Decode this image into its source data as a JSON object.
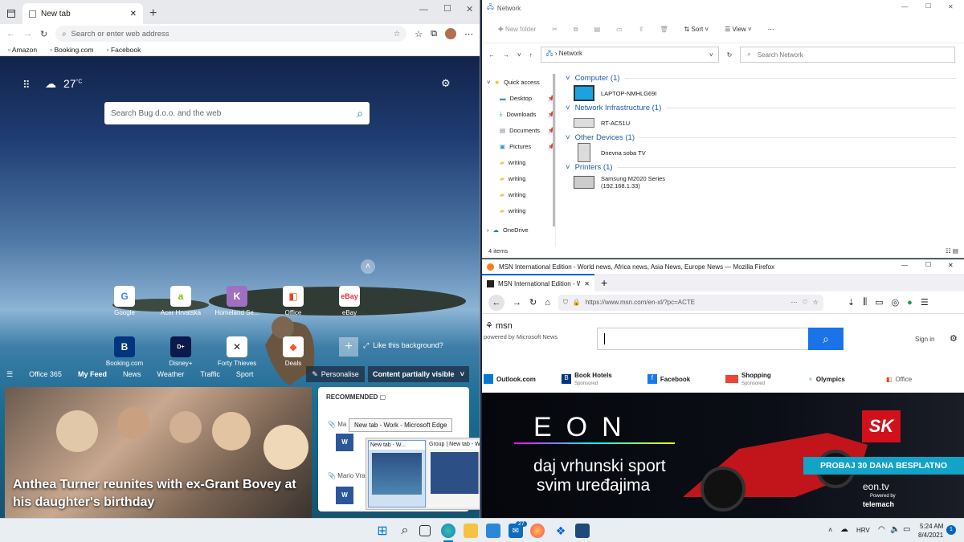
{
  "edge": {
    "tab_title": "New tab",
    "address_placeholder": "Search or enter web address",
    "favorites": [
      "Amazon",
      "Booking.com",
      "Facebook"
    ],
    "temperature": "27",
    "temp_unit": "°C",
    "search_placeholder": "Search Bug d.o.o. and the web",
    "tiles_row1": [
      "Google",
      "Acer Hrvatska",
      "Homeland Se...",
      "Office",
      "eBay"
    ],
    "tiles_row2": [
      "Booking.com",
      "Disney+",
      "Forty Thieves",
      "Deals"
    ],
    "like_background": "Like this background?",
    "feed_items": [
      "Office 365",
      "My Feed",
      "News",
      "Weather",
      "Traffic",
      "Sport"
    ],
    "personalise_label": "Personalise",
    "content_visibility": "Content partially visible",
    "headline": "Anthea Turner reunites with ex-Grant Bovey at his daughter's birthday",
    "recommended_label": "RECOMMENDED",
    "rec_items": [
      "Ma",
      "Mario Vra"
    ],
    "tooltip": "New tab - Work - Microsoft Edge",
    "thumb_titles": [
      "New tab - W...",
      "Group | New tab - Wo..."
    ]
  },
  "explorer": {
    "title": "Network",
    "cmd": {
      "new_folder": "New folder",
      "sort": "Sort",
      "view": "View"
    },
    "path": "Network",
    "search_placeholder": "Search Network",
    "nav": [
      {
        "label": "Quick access",
        "icon": "star-icon"
      },
      {
        "label": "Desktop",
        "icon": "desktop-folder-icon"
      },
      {
        "label": "Downloads",
        "icon": "download-folder-icon"
      },
      {
        "label": "Documents",
        "icon": "documents-folder-icon"
      },
      {
        "label": "Pictures",
        "icon": "pictures-folder-icon"
      },
      {
        "label": "writing",
        "icon": "folder-icon"
      },
      {
        "label": "writing",
        "icon": "folder-icon"
      },
      {
        "label": "writing",
        "icon": "folder-icon"
      },
      {
        "label": "writing",
        "icon": "folder-icon"
      },
      {
        "label": "OneDrive",
        "icon": "onedrive-icon"
      }
    ],
    "groups": [
      {
        "header": "Computer (1)",
        "device": "LAPTOP-NMHLG69I",
        "device_line2": ""
      },
      {
        "header": "Network Infrastructure (1)",
        "device": "RT-AC51U",
        "device_line2": ""
      },
      {
        "header": "Other Devices (1)",
        "device": "Dnevna soba TV",
        "device_line2": ""
      },
      {
        "header": "Printers (1)",
        "device": "Samsung M2020 Series",
        "device_line2": "(192.168.1.33)"
      }
    ],
    "status": "4 items"
  },
  "firefox": {
    "window_title": "MSN International Edition - World news, Africa news, Asia News, Europe News — Mozilla Firefox",
    "tab_title": "MSN International Edition - Wo",
    "url": "https://www.msn.com/en-xl/?pc=ACTE",
    "msn_logo": "msn",
    "powered_by": "powered by Microsoft News",
    "sign_in": "Sign in",
    "links": [
      {
        "label": "Outlook.com",
        "sub": ""
      },
      {
        "label": "Book Hotels",
        "sub": "Sponsored"
      },
      {
        "label": "Facebook",
        "sub": ""
      },
      {
        "label": "Shopping",
        "sub": "Sponsored"
      },
      {
        "label": "Olympics",
        "sub": ""
      },
      {
        "label": "Office",
        "sub": ""
      }
    ],
    "promo": {
      "brand": "EON",
      "line1": "daj vrhunski sport",
      "line2": "svim uređajima",
      "badge": "SK",
      "cta": "PROBAJ 30 DANA BESPLATNO",
      "site": "eon.tv",
      "powered": "Powered by",
      "partner": "telemach"
    }
  },
  "taskbar": {
    "language": "HRV",
    "time": "5:24 AM",
    "date": "8/4/2021",
    "badge_count": "27",
    "notification_count": "1"
  }
}
